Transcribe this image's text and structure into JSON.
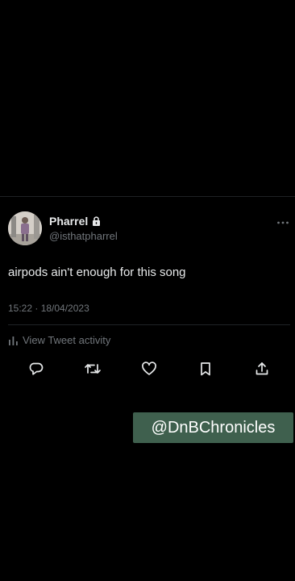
{
  "tweet": {
    "display_name": "Pharrel",
    "handle": "@isthatpharrel",
    "text": "airpods ain't enough for this song",
    "timestamp": "15:22 · 18/04/2023",
    "activity_label": "View Tweet activity",
    "icons": {
      "verified": "lock-icon",
      "more": "more-horizontal-icon",
      "activity": "bar-chart-icon",
      "actions": [
        "reply-icon",
        "retweet-icon",
        "like-icon",
        "bookmark-icon",
        "share-icon"
      ]
    }
  },
  "watermark": {
    "text": "@DnBChronicles"
  },
  "colors": {
    "background": "#000000",
    "primary_text": "#e7e9ea",
    "secondary_text": "#71767b",
    "watermark_bg": "#3f604e"
  }
}
